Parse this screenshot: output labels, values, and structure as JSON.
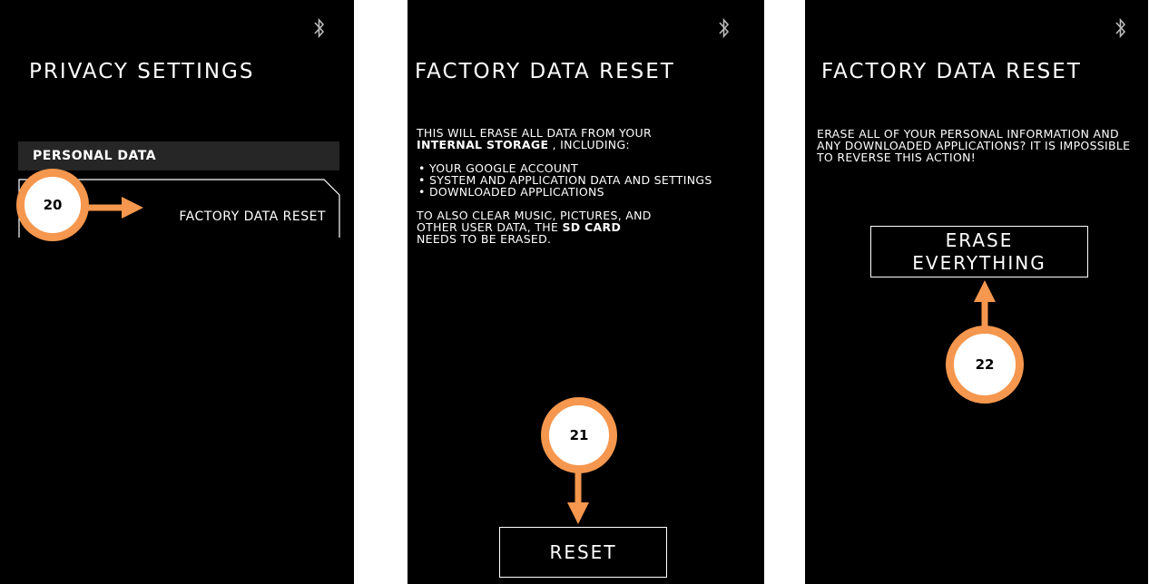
{
  "screen1": {
    "title": "PRIVACY SETTINGS",
    "section_header": "PERSONAL DATA",
    "item_label": "FACTORY DATA RESET",
    "bluetooth_icon": "bluetooth-icon",
    "annotation": "20"
  },
  "screen2": {
    "title": "FACTORY DATA RESET",
    "intro_line1": "THIS WILL ERASE ALL DATA FROM YOUR",
    "intro_bold": "INTERNAL STORAGE",
    "intro_rest": " , INCLUDING:",
    "bullets": [
      "YOUR GOOGLE ACCOUNT",
      "SYSTEM AND APPLICATION DATA AND SETTINGS",
      "DOWNLOADED APPLICATIONS"
    ],
    "outro_line1": "TO ALSO CLEAR MUSIC, PICTURES, AND",
    "outro_line2_a": "OTHER USER DATA, THE ",
    "outro_bold": "SD CARD",
    "outro_line3": "NEEDS TO BE ERASED.",
    "button_label": "RESET",
    "annotation": "21"
  },
  "screen3": {
    "title": "FACTORY DATA RESET",
    "message": "ERASE ALL OF YOUR PERSONAL INFORMATION AND ANY DOWNLOADED APPLICATIONS? IT IS IMPOSSIBLE TO REVERSE THIS ACTION!",
    "button_line1": "ERASE",
    "button_line2": "EVERYTHING",
    "annotation": "22"
  },
  "colors": {
    "annotation_orange": "#F5974E",
    "screen_bg": "#000000",
    "section_header_bg": "#262626"
  }
}
